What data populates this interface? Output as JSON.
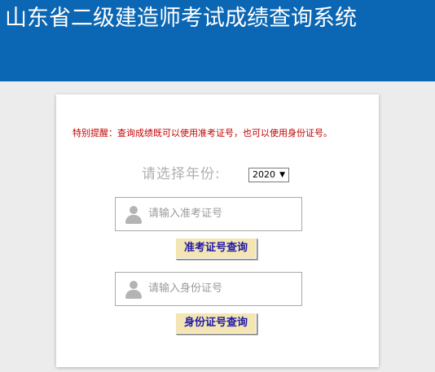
{
  "header": {
    "title": "山东省二级建造师考试成绩查询系统"
  },
  "notice": {
    "text": "特别提醒：查询成绩既可以使用准考证号，也可以使用身份证号。"
  },
  "year": {
    "label": "请选择年份:",
    "selected": "2020",
    "caret": "▼"
  },
  "exam_input": {
    "placeholder": "请输入准考证号",
    "value": ""
  },
  "exam_button": {
    "label": "准考证号查询"
  },
  "id_input": {
    "placeholder": "请输入身份证号",
    "value": ""
  },
  "id_button": {
    "label": "身份证号查询"
  },
  "colors": {
    "header_bg": "#0b66b3",
    "notice_text": "#c00000",
    "button_bg": "#f3e6b4",
    "button_text": "#2018a8"
  }
}
